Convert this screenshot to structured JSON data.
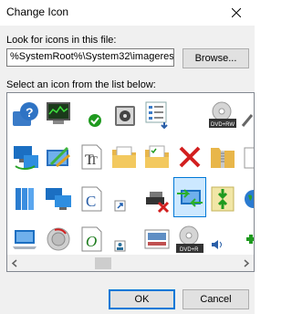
{
  "window": {
    "title": "Change Icon"
  },
  "lookfor": {
    "label": "Look for icons in this file:",
    "path_value": "%SystemRoot%\\System32\\imageres",
    "browse_label": "Browse..."
  },
  "list": {
    "label": "Select an icon from the list below:",
    "badge_rw": "DVD+RW",
    "badge_r": "DVD+R",
    "badge_t": "T",
    "badge_c": "C",
    "badge_o": "O"
  },
  "buttons": {
    "ok": "OK",
    "cancel": "Cancel"
  },
  "icons": [
    "help-icon",
    "system-monitor-icon",
    "check-icon",
    "media-player-icon",
    "checklist-icon",
    "dvd-rw-icon",
    "network-computer-icon",
    "ruler-window-icon",
    "font-tt-icon",
    "documents-folder-icon",
    "checklist-folder-icon",
    "delete-icon",
    "zip-folder-icon",
    "library-icon",
    "computer-pair-icon",
    "font-c-icon",
    "shortcut-arrow-icon",
    "drive-error-icon",
    "sync-screen-icon",
    "compress-arrows-icon",
    "globe-icon",
    "monitor-icon",
    "sound-speaker-icon",
    "font-o-icon",
    "user-tile-icon",
    "image-slide-icon",
    "dvd-r-icon",
    "speaker-small-icon",
    "add-icon"
  ]
}
